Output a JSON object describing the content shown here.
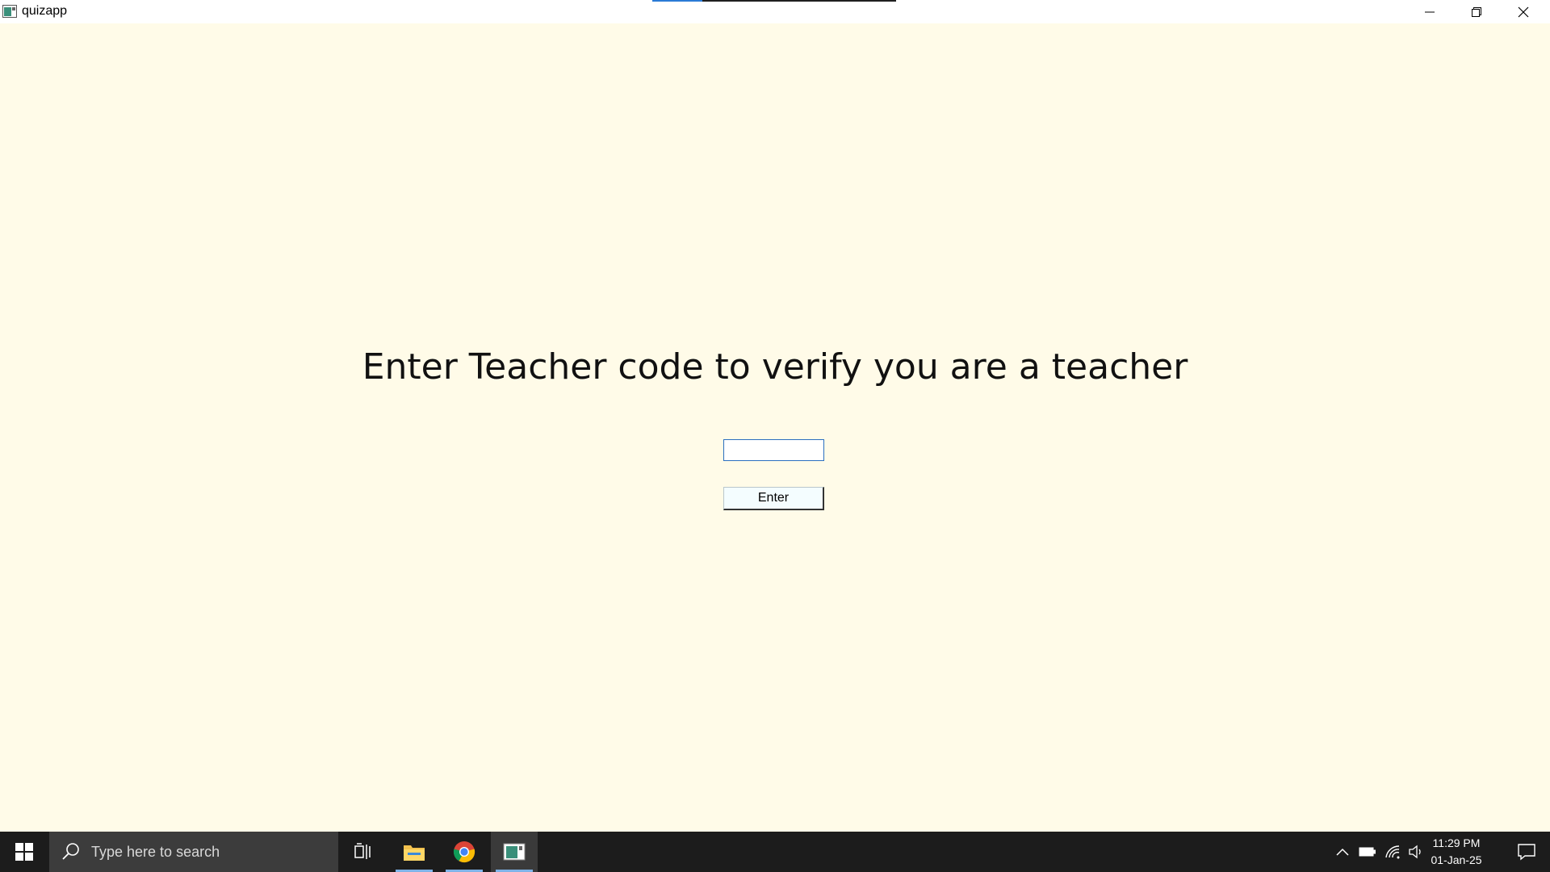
{
  "window": {
    "title": "quizapp",
    "icon": "app-window-icon",
    "controls": [
      "minimize-icon",
      "restore-icon",
      "close-icon"
    ]
  },
  "main": {
    "heading": "Enter Teacher code to verify you are a teacher",
    "code_input": {
      "value": "",
      "placeholder": ""
    },
    "enter_label": "Enter"
  },
  "taskbar": {
    "search_placeholder": "Type here to search",
    "apps": [
      "task-view-icon",
      "file-explorer-icon",
      "chrome-icon",
      "quizapp-icon"
    ],
    "tray": [
      "show-hidden-icons-icon",
      "battery-icon",
      "wifi-icon",
      "volume-icon"
    ],
    "time": "11:29 PM",
    "date": "01-Jan-25"
  },
  "colors": {
    "background": "#fffbe8",
    "taskbar": "#1c1c1c",
    "accent": "#2b6fbf"
  }
}
